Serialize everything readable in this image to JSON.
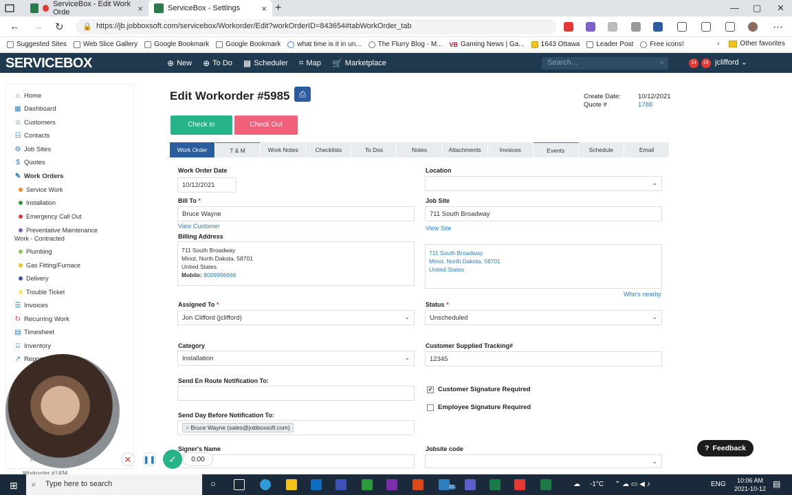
{
  "browser": {
    "tabs": [
      {
        "label": "ServiceBox - Edit Work Orde",
        "active": true
      },
      {
        "label": "ServiceBox - Settings",
        "active": false
      }
    ],
    "url": "https://jb.jobboxsoft.com/servicebox/Workorder/Edit?workOrderID=843654#tabWorkOrder_tab",
    "bookmarks": [
      "Suggested Sites",
      "Web Slice Gallery",
      "Google Bookmark",
      "Google Bookmark",
      "what time is it in un...",
      "The Flurry Blog - M...",
      "Gaming News | Ga...",
      "1643 Ottawa",
      "Leader Post",
      "Free icons!"
    ],
    "other_favorites": "Other favorites",
    "vb_label": "VB"
  },
  "app": {
    "logo": "SERVICEBOX",
    "nav": [
      "New",
      "To Do",
      "Scheduler",
      "Map",
      "Marketplace"
    ],
    "search_placeholder": "Search...",
    "notif_counts": [
      "14",
      "24"
    ],
    "user": "jclifford"
  },
  "sidebar": {
    "items": [
      "Home",
      "Dashboard",
      "Customers",
      "Contacts",
      "Job Sites",
      "Quotes",
      "Work Orders"
    ],
    "sub_items": [
      {
        "label": "Service Work",
        "color": "#f08c2e"
      },
      {
        "label": "Installation",
        "color": "#2e9a3e"
      },
      {
        "label": "Emergency Call Out",
        "color": "#e53935"
      },
      {
        "label": "Preventative Maintenance",
        "color": "#7b61c9"
      },
      {
        "label": "Work - Contracted",
        "color": ""
      },
      {
        "label": "Plumbing",
        "color": "#8bc34a"
      },
      {
        "label": "Gas Fitting/Furnace",
        "color": "#f0c419"
      },
      {
        "label": "Delivery",
        "color": "#3f51b5"
      },
      {
        "label": "Trouble Ticket",
        "color": "#f5e663"
      }
    ],
    "bottom_items": [
      "Invoices",
      "Recurring Work",
      "Timesheet",
      "Inventory",
      "Reports"
    ],
    "partial_text": "Workorder #1494",
    "partial_prefix": "7l"
  },
  "workorder": {
    "title": "Edit Workorder #5985",
    "create_date_label": "Create Date:",
    "create_date": "10/12/2021",
    "quote_label": "Quote #",
    "quote_value": "1788",
    "check_in": "Check In",
    "check_out": "Check Out",
    "tabs": [
      "Work Order",
      "T & M",
      "Work Notes",
      "Checklists",
      "To Dos",
      "Notes",
      "Attachments",
      "Invoices",
      "Events",
      "Schedule",
      "Email"
    ],
    "fields": {
      "work_order_date_label": "Work Order Date",
      "work_order_date": "10/12/2021",
      "location_label": "Location",
      "location_value": "",
      "bill_to_label": "Bill To",
      "bill_to_value": "Bruce Wayne",
      "view_customer": "View Customer",
      "job_site_label": "Job Site",
      "job_site_value": "711 South Broadway",
      "view_site": "View Site",
      "billing_address_label": "Billing Address",
      "billing_address_lines": [
        "711 South Broadway",
        "Minot, North Dakota, 58701",
        "United States"
      ],
      "mobile_label": "Mobile:",
      "mobile_value": "8009996666",
      "site_address_lines": [
        "711 South Broadway",
        "Minot, North Dakota, 58701",
        "United States"
      ],
      "whos_nearby": "Who's nearby",
      "assigned_to_label": "Assigned To",
      "assigned_to_value": "Jon Clifford (jclifford)",
      "status_label": "Status",
      "status_value": "Unscheduled",
      "category_label": "Category",
      "category_value": "Installation",
      "tracking_label": "Customer Supplied Tracking#",
      "tracking_value": "12345",
      "en_route_label": "Send En Route Notification To:",
      "customer_sig_label": "Customer Signature Required",
      "customer_sig_checked": true,
      "employee_sig_label": "Employee Signature Required",
      "employee_sig_checked": false,
      "day_before_label": "Send Day Before Notification To:",
      "day_before_chip": "Bruce Wayne (sales@jobboxsoft.com)",
      "signer_label": "Signer's Name",
      "jobsite_code_label": "Jobsite code",
      "required_mark": "*"
    },
    "feedback": "Feedback"
  },
  "recorder": {
    "time": "0:00"
  },
  "taskbar": {
    "search_placeholder": "Type here to search",
    "weather": "-1°C",
    "lang": "ENG",
    "time": "10:06 AM",
    "date": "2021-10-12",
    "badge": "21"
  },
  "colors": {
    "header": "#1f3a4e",
    "accent": "#2a5c9e",
    "check_in": "#26b38a",
    "check_out": "#f1607a",
    "link": "#2e7dbf"
  }
}
